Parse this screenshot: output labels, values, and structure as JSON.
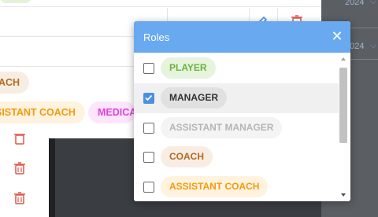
{
  "background": {
    "years": [
      "2024",
      "2024"
    ],
    "table_chips": {
      "coach": "ACH",
      "assistant_coach": "SISTANT COACH",
      "medical": "MEDICA"
    }
  },
  "dialog": {
    "title": "Roles",
    "close_glyph": "✕",
    "roles": [
      {
        "label": "PLAYER",
        "checked": false,
        "bg": "#e6f3dd",
        "fg": "#6cb33f"
      },
      {
        "label": "MANAGER",
        "checked": true,
        "bg": "#e1e1e1",
        "fg": "#333333"
      },
      {
        "label": "ASSISTANT MANAGER",
        "checked": false,
        "bg": "#f4f4f4",
        "fg": "#b5b5b5"
      },
      {
        "label": "COACH",
        "checked": false,
        "bg": "#f8ede3",
        "fg": "#b66a22"
      },
      {
        "label": "ASSISTANT COACH",
        "checked": false,
        "bg": "#fff3df",
        "fg": "#f59a0c"
      }
    ]
  },
  "colors": {
    "header": "#68a9f0",
    "checkbox_checked": "#4a90e2",
    "trash": "#e2574c"
  }
}
